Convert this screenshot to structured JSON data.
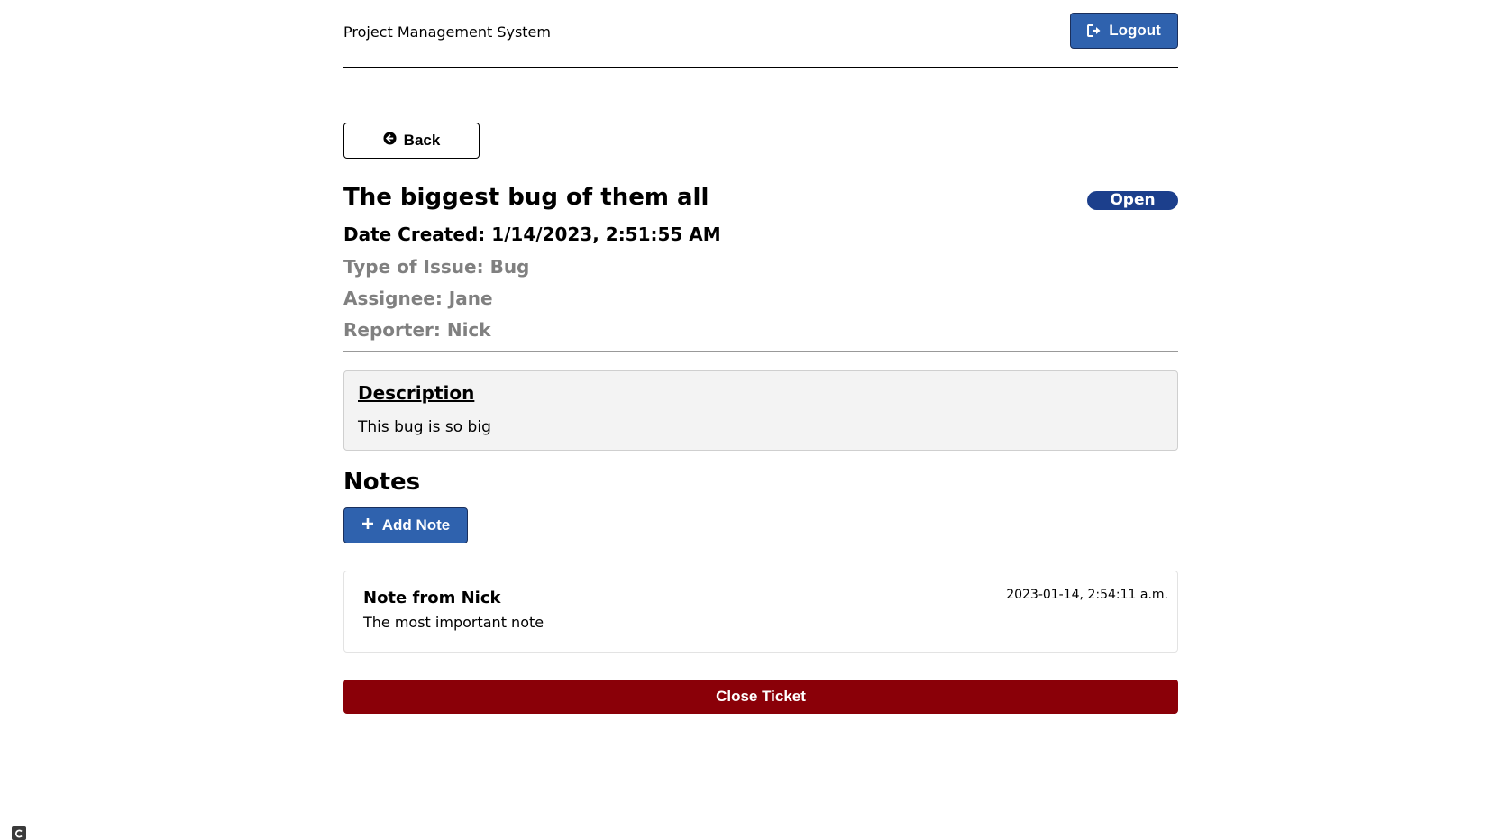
{
  "header": {
    "app_title": "Project Management System",
    "logout_label": "Logout"
  },
  "nav": {
    "back_label": "Back"
  },
  "ticket": {
    "title": "The biggest bug of them all",
    "status": "Open",
    "date_created": "Date Created: 1/14/2023, 2:51:55 AM",
    "type_of_issue": "Type of Issue: Bug",
    "assignee": "Assignee: Jane",
    "reporter": "Reporter: Nick",
    "description_heading": "Description",
    "description_text": "This bug is so big"
  },
  "notes": {
    "heading": "Notes",
    "add_label": "Add Note",
    "items": [
      {
        "author": "Note from Nick",
        "body": "The most important note",
        "date": "2023-01-14, 2:54:11 a.m."
      }
    ]
  },
  "actions": {
    "close_ticket_label": "Close Ticket"
  },
  "colors": {
    "primary_button": "#2f62ae",
    "status_badge": "#1c3f8c",
    "danger_button": "#8a0008",
    "muted_text": "#808080"
  },
  "icons": {
    "logout": "sign-out-icon",
    "back": "circle-arrow-left-icon",
    "add": "plus-icon",
    "corner": "widget-icon"
  }
}
